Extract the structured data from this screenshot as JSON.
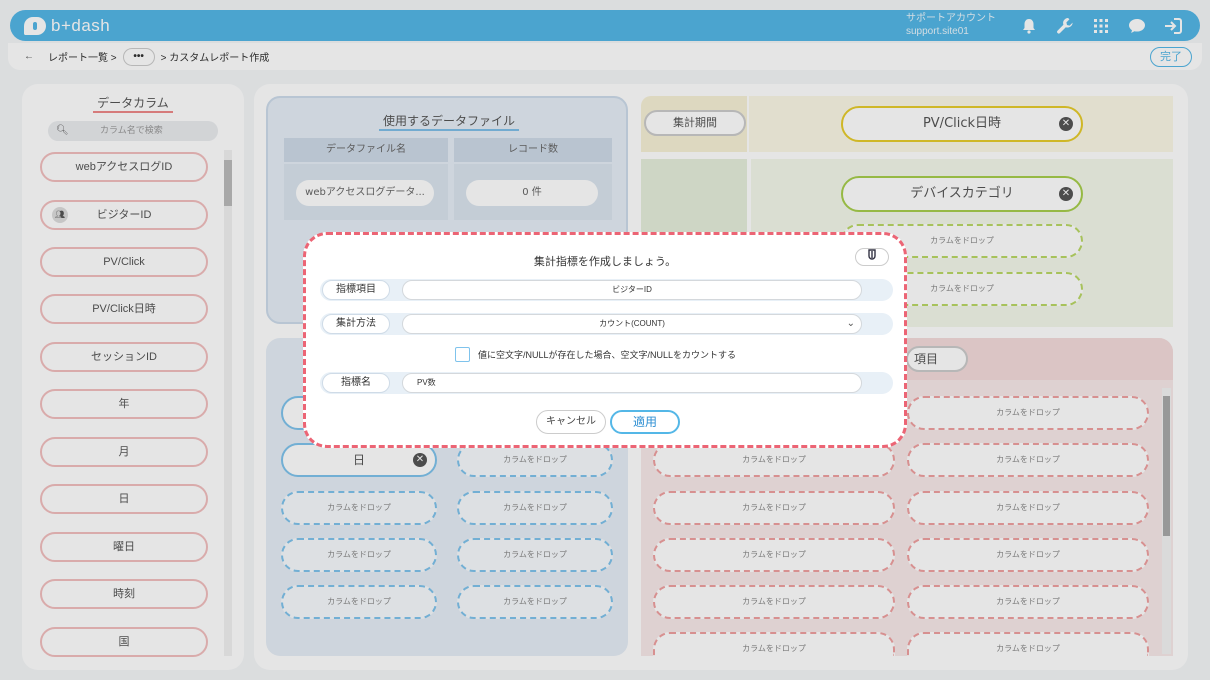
{
  "header": {
    "logo_text": "b+dash",
    "account_line1": "サポートアカウント",
    "account_line2": "support.site01",
    "icons": [
      "bell-icon",
      "wrench-icon",
      "grid-icon",
      "chat-icon",
      "logout-icon"
    ]
  },
  "subbar": {
    "back": "←",
    "breadcrumb_parent": "レポート一覧 >",
    "more": "•••",
    "breadcrumb_current": "> カスタムレポート作成",
    "done": "完了"
  },
  "columns_panel": {
    "title": "データカラム",
    "search_placeholder": "カラム名で検索",
    "items": [
      "webアクセスログID",
      "ビジターID",
      "PV/Click",
      "PV/Click日時",
      "セッションID",
      "年",
      "月",
      "日",
      "曜日",
      "時刻",
      "国"
    ]
  },
  "data_file": {
    "title": "使用するデータファイル",
    "col_name": "データファイル名",
    "col_count": "レコード数",
    "file_name": "webアクセスログデータ...",
    "record_count": "0 件"
  },
  "period": {
    "label": "集計期間",
    "chip": "PV/Click日時"
  },
  "group": {
    "chip": "デバイスカテゴリ",
    "drop_text": "カラムをドロップ"
  },
  "rows": {
    "chip": "日",
    "drop_text": "カラムをドロップ"
  },
  "metrics": {
    "label": "項目",
    "drop_text": "カラムをドロップ"
  },
  "modal": {
    "title": "集計指標を作成しましょう。",
    "hint_icon": "hint-icon",
    "metric_item_label": "指標項目",
    "metric_item_value": "ビジターID",
    "method_label": "集計方法",
    "method_value": "カウント(COUNT)",
    "checkbox_label": "値に空文字/NULLが存在した場合、空文字/NULLをカウントする",
    "name_label": "指標名",
    "name_value": "PV数",
    "cancel": "キャンセル",
    "apply": "適用"
  }
}
